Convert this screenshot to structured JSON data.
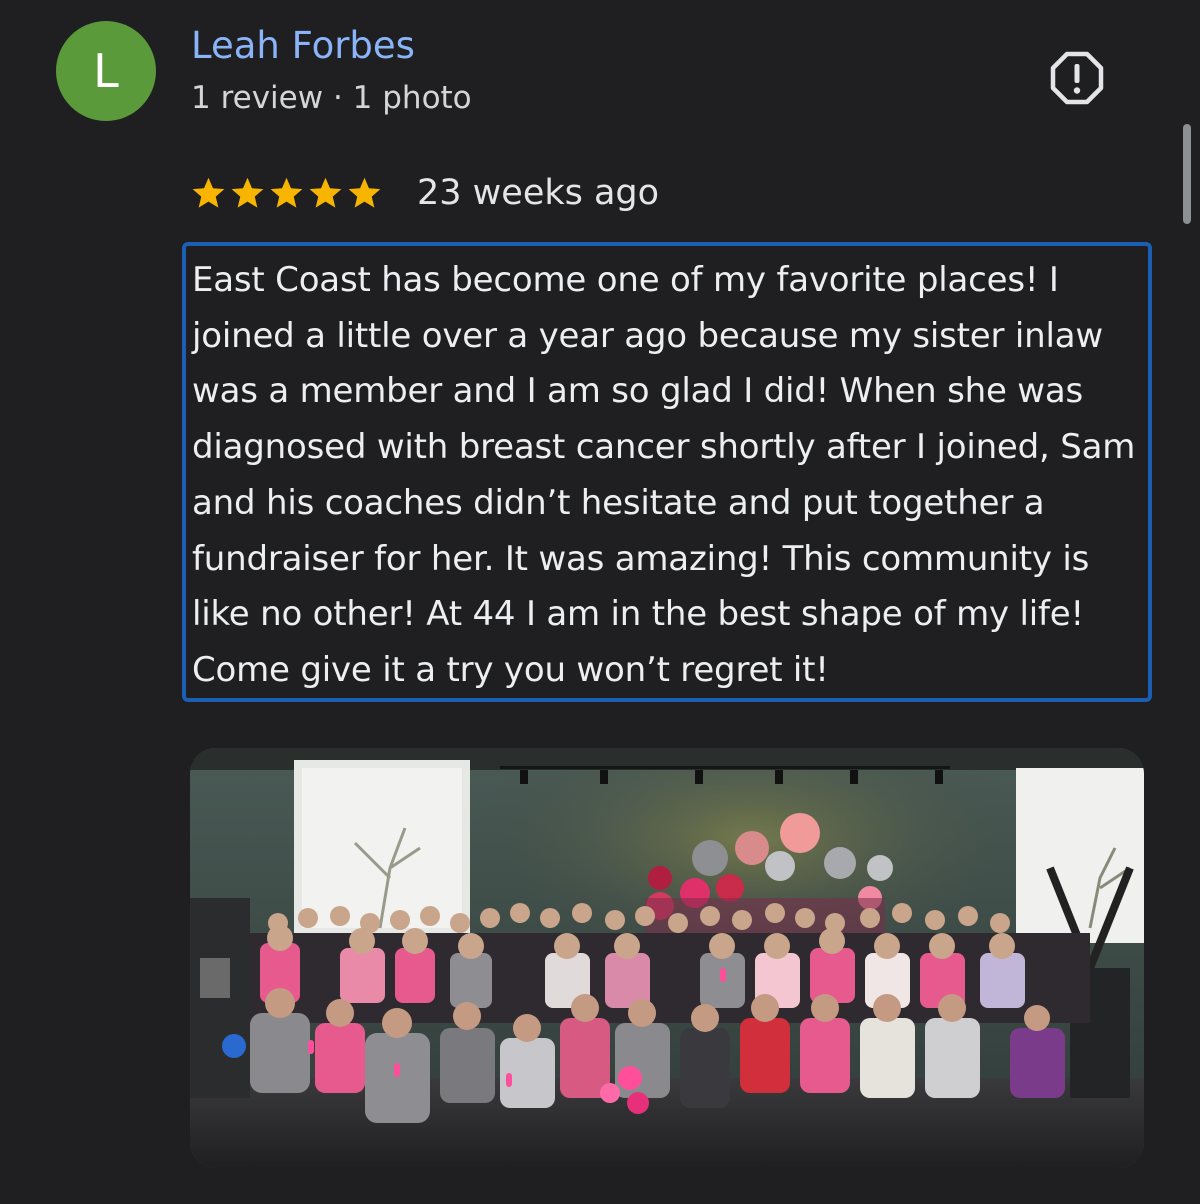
{
  "reviewer": {
    "avatar_initial": "L",
    "name": "Leah Forbes",
    "meta": "1 review · 1 photo",
    "avatar_color": "#5b9a3a"
  },
  "review": {
    "rating": 5,
    "rating_max": 5,
    "time_ago": "23 weeks ago",
    "text": "East Coast has become one of my favorite places! I joined a little over a year ago because my sister inlaw was a member and I am so glad I did! When she was diagnosed with breast cancer shortly after I joined, Sam and his coaches didn’t hesitate and put together a fundraiser for her. It was amazing! This community is like no other! At 44 I am in the best shape of my life! Come give it a try you won’t regret it!",
    "photo_count": 1
  },
  "icons": {
    "report": "report-flag-icon",
    "star": "star-icon"
  },
  "colors": {
    "background": "#1f1f22",
    "name_link": "#8ab4f8",
    "star": "#f7b500",
    "focus_border": "#1a5fb4"
  }
}
